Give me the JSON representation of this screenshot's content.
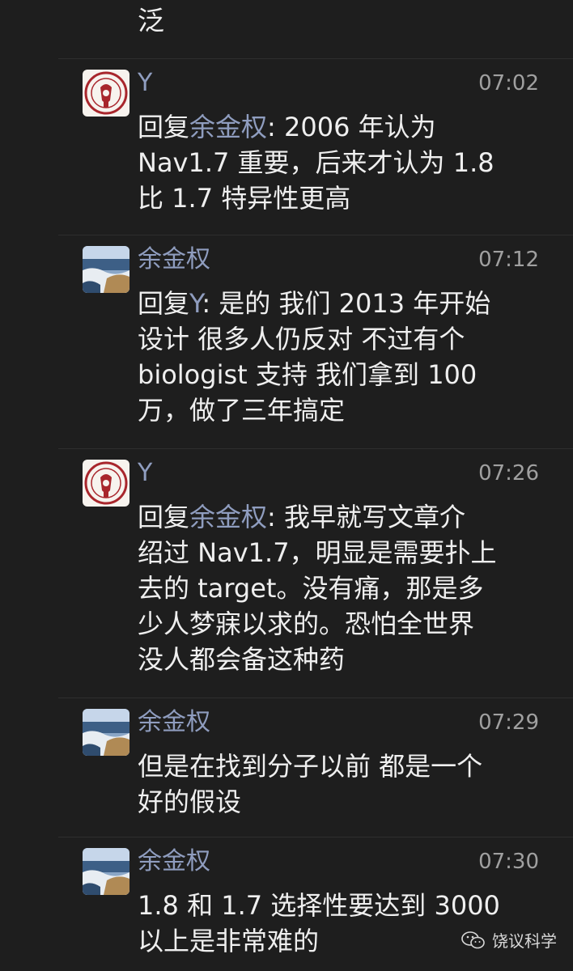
{
  "top_fragment": "泛",
  "messages": [
    {
      "sender": "Y",
      "time": "07:02",
      "reply_prefix": "回复",
      "reply_to": "余金权",
      "lines": [
        ": 2006 年认为",
        "Nav1.7 重要，后来才认为 1.8",
        "比 1.7 特异性更高"
      ]
    },
    {
      "sender": "余金权",
      "time": "07:12",
      "reply_prefix": "回复",
      "reply_to": "Y",
      "lines": [
        ": 是的 我们 2013 年开始",
        "设计 很多人仍反对 不过有个",
        "biologist 支持 我们拿到 100",
        "万，做了三年搞定"
      ]
    },
    {
      "sender": "Y",
      "time": "07:26",
      "reply_prefix": "回复",
      "reply_to": "余金权",
      "lines": [
        ": 我早就写文章介",
        "绍过 Nav1.7，明显是需要扑上",
        "去的 target。没有痛，那是多",
        "少人梦寐以求的。恐怕全世界",
        "没人都会备这种药"
      ]
    },
    {
      "sender": "余金权",
      "time": "07:29",
      "lines": [
        "但是在找到分子以前 都是一个",
        "好的假设"
      ]
    },
    {
      "sender": "余金权",
      "time": "07:30",
      "lines": [
        "1.8 和 1.7 选择性要达到 3000",
        "以上是非常难的"
      ]
    }
  ],
  "watermark": {
    "text": "饶议科学"
  },
  "icons": {
    "seal_avatar": "university-seal-icon",
    "ocean_avatar": "ocean-landscape-icon",
    "watermark": "wechat-icon"
  },
  "colors": {
    "background": "#1e1e1e",
    "text": "#efefef",
    "name": "#8f9dbf",
    "time": "#a0a0a0"
  }
}
